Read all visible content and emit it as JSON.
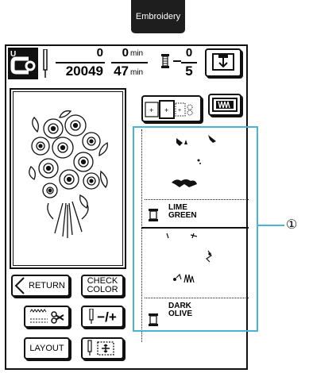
{
  "top_tab": {
    "label": "Embroidery"
  },
  "status": {
    "stitch_current": "0",
    "stitch_total": "20049",
    "time_current": "0",
    "time_total": "47",
    "time_unit": "min",
    "color_current": "0",
    "color_total": "5"
  },
  "buttons": {
    "return": "RETURN",
    "check_color_line1": "CHECK",
    "check_color_line2": "COLOR",
    "layout": "LAYOUT",
    "tension": "−/+"
  },
  "thread_colors": [
    {
      "line1": "LIME",
      "line2": "GREEN"
    },
    {
      "line1": "DARK",
      "line2": "OLIVE"
    }
  ],
  "callout": {
    "label": "①"
  },
  "colors": {
    "callout": "#4bb4d6",
    "lcd": "#111111"
  }
}
